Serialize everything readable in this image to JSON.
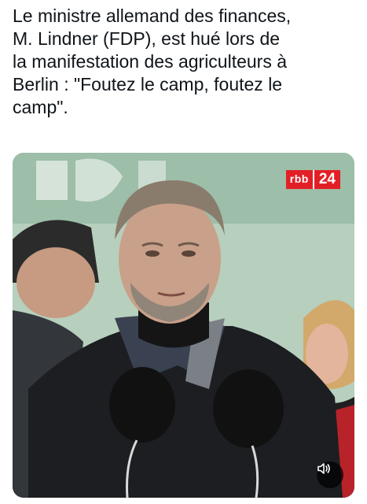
{
  "post": {
    "lines": [
      "Le ministre allemand des finances,",
      "M. Lindner (FDP), est hué lors de",
      "la manifestation des agriculteurs à",
      "Berlin : \"Foutez le camp, foutez le",
      "camp\"."
    ]
  },
  "video": {
    "channel_logo_part1": "rbb",
    "channel_logo_part2": "24",
    "sound_icon": "speaker-icon",
    "colors": {
      "logo_red": "#e31f26",
      "background_green": "#a9c7b3"
    }
  }
}
